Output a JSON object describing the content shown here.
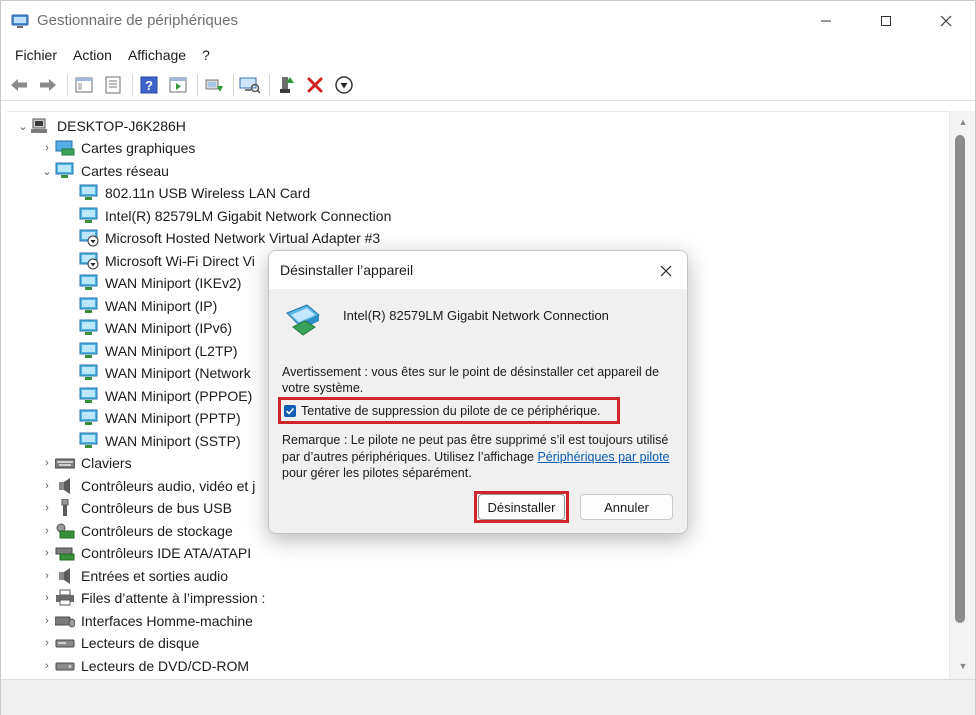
{
  "window": {
    "title": "Gestionnaire de périphériques",
    "controls": {
      "minimize": "—",
      "maximize": "☐",
      "close": "✕"
    }
  },
  "menu": [
    "Fichier",
    "Action",
    "Affichage",
    "?"
  ],
  "toolbar": [
    "back-icon",
    "forward-icon",
    "show-hide-console-tree-icon",
    "properties-icon",
    "help-icon",
    "action-pane-icon",
    "update-driver-icon",
    "scan-hardware-icon",
    "enable-device-icon",
    "uninstall-device-icon",
    "disable-device-icon"
  ],
  "tree": {
    "root": "DESKTOP-J6K286H",
    "items": [
      {
        "label": "Cartes graphiques",
        "expanded": false
      },
      {
        "label": "Cartes réseau",
        "expanded": true
      },
      {
        "label": "802.11n USB Wireless LAN Card"
      },
      {
        "label": "Intel(R) 82579LM Gigabit Network Connection"
      },
      {
        "label": "Microsoft Hosted Network Virtual Adapter #3"
      },
      {
        "label": "Microsoft Wi-Fi Direct Vi"
      },
      {
        "label": "WAN Miniport (IKEv2)"
      },
      {
        "label": "WAN Miniport (IP)"
      },
      {
        "label": "WAN Miniport (IPv6)"
      },
      {
        "label": "WAN Miniport (L2TP)"
      },
      {
        "label": "WAN Miniport (Network"
      },
      {
        "label": "WAN Miniport (PPPOE)"
      },
      {
        "label": "WAN Miniport (PPTP)"
      },
      {
        "label": "WAN Miniport (SSTP)"
      },
      {
        "label": "Claviers",
        "expanded": false
      },
      {
        "label": "Contrôleurs audio, vidéo et j",
        "expanded": false
      },
      {
        "label": "Contrôleurs de bus USB",
        "expanded": false
      },
      {
        "label": "Contrôleurs de stockage",
        "expanded": false
      },
      {
        "label": "Contrôleurs IDE ATA/ATAPI",
        "expanded": false
      },
      {
        "label": "Entrées et sorties audio",
        "expanded": false
      },
      {
        "label": "Files d’attente à l’impression :",
        "expanded": false
      },
      {
        "label": "Interfaces Homme-machine",
        "expanded": false
      },
      {
        "label": "Lecteurs de disque",
        "expanded": false
      },
      {
        "label": "Lecteurs de DVD/CD-ROM",
        "expanded": false
      }
    ]
  },
  "dialog": {
    "title": "Désinstaller l’appareil",
    "device_name": "Intel(R) 82579LM Gigabit Network Connection",
    "warning": "Avertissement : vous êtes sur le point de désinstaller cet appareil de votre système.",
    "checkbox_label": "Tentative de suppression du pilote de ce périphérique.",
    "checkbox_checked": true,
    "remark_before": "Remarque : Le pilote ne peut pas être supprimé s’il est toujours utilisé par d’autres périphériques. Utilisez l’affichage ",
    "remark_link": "Périphériques par pilote",
    "remark_after": " pour gérer les pilotes séparément.",
    "uninstall_button": "Désinstaller",
    "cancel_button": "Annuler"
  },
  "colors": {
    "highlight_red": "#d1252e",
    "link_blue": "#0a5bb5",
    "checkbox_blue": "#0f5fb4"
  }
}
